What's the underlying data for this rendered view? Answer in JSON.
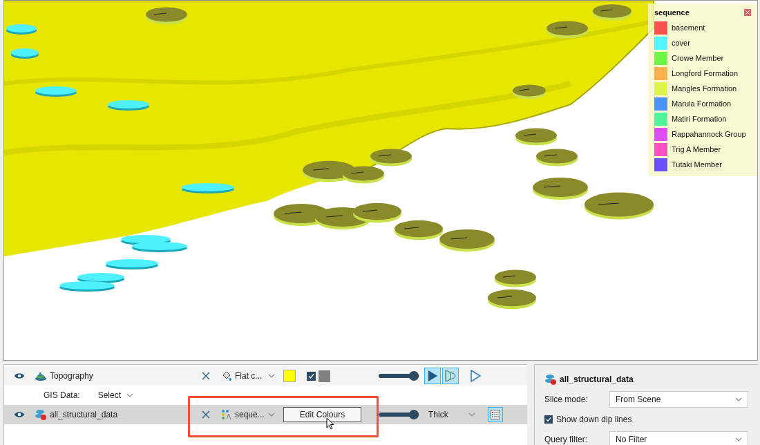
{
  "legend": {
    "title": "sequence",
    "items": [
      {
        "name": "basement",
        "color": "#ff4f4f"
      },
      {
        "name": "cover",
        "color": "#4ff5ff"
      },
      {
        "name": "Crowe Member",
        "color": "#6ef54a"
      },
      {
        "name": "Longford Formation",
        "color": "#ffb04f"
      },
      {
        "name": "Mangles Formation",
        "color": "#dcf54a"
      },
      {
        "name": "Maruia Formation",
        "color": "#4f90ff"
      },
      {
        "name": "Matiri Formation",
        "color": "#4ff59a"
      },
      {
        "name": "Rappahannock Group",
        "color": "#e04fff"
      },
      {
        "name": "Trig A Member",
        "color": "#ff4fc0"
      },
      {
        "name": "Tutaki Member",
        "color": "#6a4fff"
      }
    ]
  },
  "layers": [
    {
      "kind": "surface",
      "name": "Topography",
      "visible": true,
      "selected": false,
      "colour_mode": "Flat c...",
      "color": "#ffff00",
      "edges": {
        "checked": true,
        "color": "#808080"
      },
      "level": 1,
      "render_modes": [
        {
          "kind": "solid",
          "selected": true
        },
        {
          "kind": "transparent",
          "selected": true
        },
        {
          "kind": "outline",
          "selected": false
        }
      ],
      "gis": {
        "label": "GIS Data:",
        "value": "Select"
      }
    },
    {
      "kind": "points",
      "name": "all_structural_data",
      "visible": true,
      "selected": true,
      "colour_mode": "seque...",
      "button": "Edit Colours",
      "level": 1,
      "thickness": "Thick",
      "legend_on": true
    }
  ],
  "properties": {
    "title": "all_structural_data",
    "slice_label": "Slice mode:",
    "slice_value": "From Scene",
    "down_dip": {
      "label": "Show down dip lines",
      "checked": true
    },
    "filter_label": "Query filter:",
    "filter_value": "No Filter"
  }
}
